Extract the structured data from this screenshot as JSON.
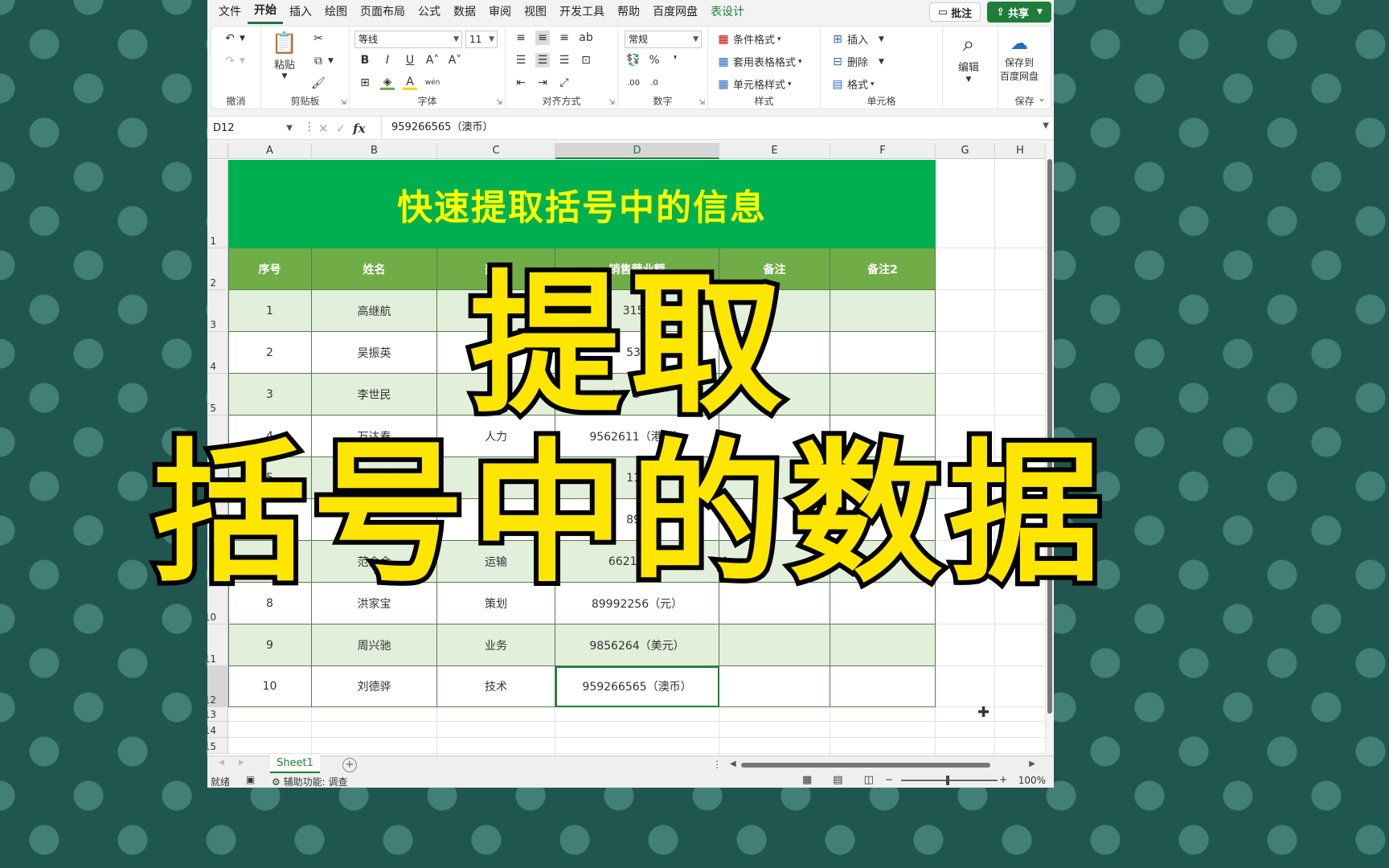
{
  "menu": {
    "tabs": [
      "文件",
      "开始",
      "插入",
      "绘图",
      "页面布局",
      "公式",
      "数据",
      "审阅",
      "视图",
      "开发工具",
      "帮助",
      "百度网盘",
      "表设计"
    ],
    "active": "开始",
    "comment_label": "批注",
    "share_label": "共享"
  },
  "ribbon": {
    "undo_group": "撤消",
    "clipboard_group": "剪贴板",
    "paste_label": "粘贴",
    "font_group": "字体",
    "font_name": "等线",
    "font_size": "11",
    "align_group": "对齐方式",
    "number_group": "数字",
    "number_format": "常规",
    "styles_group": "样式",
    "cond_format": "条件格式",
    "table_format": "套用表格格式",
    "cell_styles": "单元格样式",
    "cells_group": "单元格",
    "insert": "插入",
    "delete": "删除",
    "format": "格式",
    "edit": "编辑",
    "save_group": "保存",
    "save_to_label_1": "保存到",
    "save_to_label_2": "百度网盘"
  },
  "formula_bar": {
    "name_box": "D12",
    "formula": "959266565（澳币）",
    "fx": "fx"
  },
  "columns": [
    "A",
    "B",
    "C",
    "D",
    "E",
    "F",
    "G",
    "H"
  ],
  "rows": [
    "1",
    "2",
    "3",
    "4",
    "5",
    "6",
    "7",
    "8",
    "9",
    "10",
    "11",
    "12",
    "13",
    "14",
    "15"
  ],
  "sheet": {
    "title": "快速提取括号中的信息",
    "headers": [
      "序号",
      "姓名",
      "部门",
      "销售营业额",
      "备注",
      "备注2"
    ],
    "data": [
      [
        "1",
        "高继航",
        "",
        "3153",
        "",
        ""
      ],
      [
        "2",
        "吴振英",
        "",
        "532",
        "",
        ""
      ],
      [
        "3",
        "李世民",
        "和",
        "5",
        "",
        ""
      ],
      [
        "4",
        "万达春",
        "人力",
        "9562611（港币）",
        "",
        ""
      ],
      [
        "5",
        "吴",
        "运",
        "118",
        "",
        ""
      ],
      [
        "6",
        "",
        "宣",
        "898",
        "",
        ""
      ],
      [
        "7",
        "范金金",
        "运输",
        "66215522",
        "",
        ""
      ],
      [
        "8",
        "洪家宝",
        "策划",
        "89992256（元）",
        "",
        ""
      ],
      [
        "9",
        "周兴驰",
        "业务",
        "9856264（美元）",
        "",
        ""
      ],
      [
        "10",
        "刘德骅",
        "技术",
        "959266565（澳币）",
        "",
        ""
      ]
    ]
  },
  "sheet_tab": "Sheet1",
  "status": {
    "ready": "就绪",
    "accessibility": "辅助功能: 调查",
    "zoom": "100%"
  },
  "overlay": {
    "line1": "提取",
    "line2": "括号中的数据"
  },
  "colors": {
    "title_bg": "#00b050",
    "title_text": "#ffff00",
    "header_bg": "#70ad47",
    "band": "#e2efda",
    "accent": "#1e7d3a",
    "overlay_text": "#ffe600"
  }
}
